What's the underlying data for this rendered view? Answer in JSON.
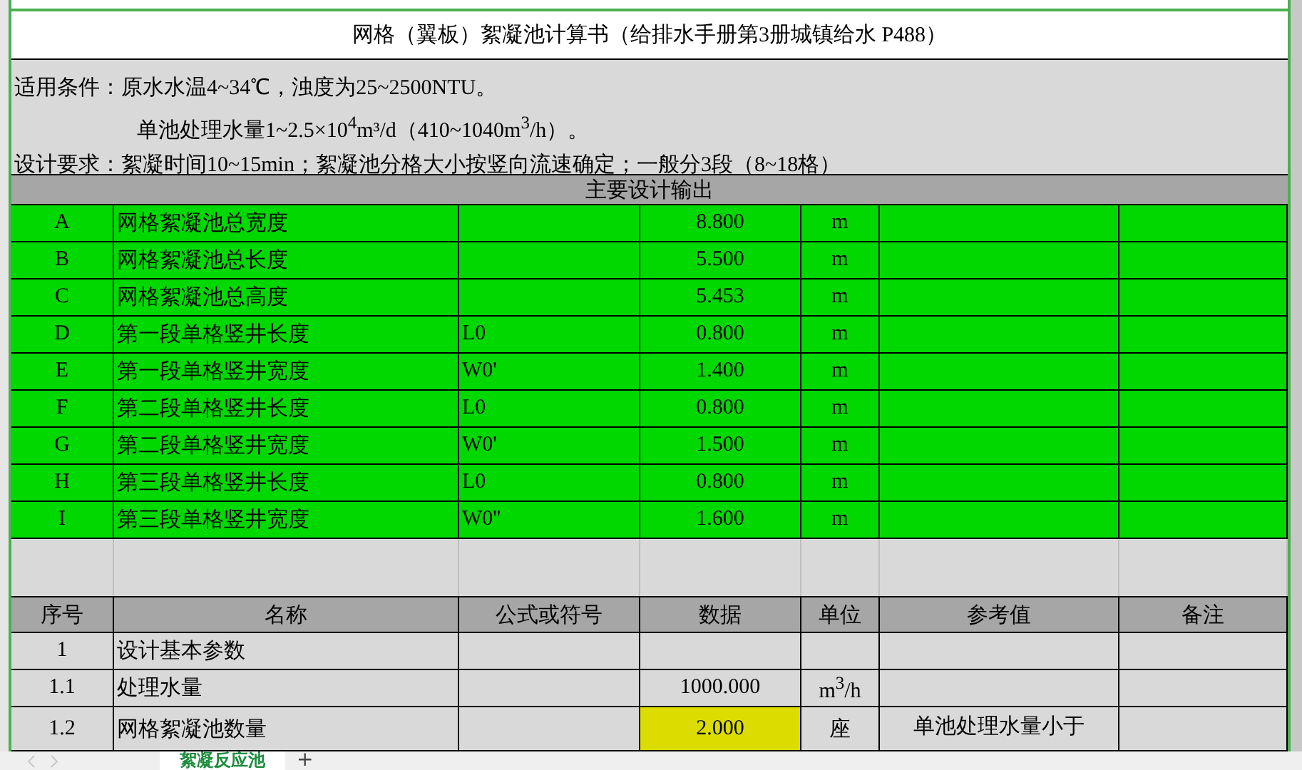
{
  "title": "网格（翼板）絮凝池计算书（给排水手册第3册城镇给水 P488）",
  "conditions": [
    {
      "text": "适用条件：原水水温4~34℃，浊度为25~2500NTU。",
      "indent": false
    },
    {
      "text": "单池处理水量1~2.5×10$^{4}$m³/d（410~1040m$^{3}$/h）。",
      "indent": true
    },
    {
      "text": "设计要求：絮凝时间10~15min；絮凝池分格大小按竖向流速确定；一般分3段（8~18格）",
      "indent": false
    }
  ],
  "output": {
    "heading": "主要设计输出",
    "rows": [
      {
        "code": "A",
        "name": "网格絮凝池总宽度",
        "value": "8.800",
        "unit": "m"
      },
      {
        "code": "B",
        "name": "网格絮凝池总长度",
        "value": "5.500",
        "unit": "m"
      },
      {
        "code": "C",
        "name": "网格絮凝池总高度",
        "value": "5.453",
        "unit": "m"
      },
      {
        "code": "D",
        "name": "第一段单格竖井长度",
        "symbol": "L0",
        "value": "0.800",
        "unit": "m"
      },
      {
        "code": "E",
        "name": "第一段单格竖井宽度",
        "symbol": "W0'",
        "value": "1.400",
        "unit": "m"
      },
      {
        "code": "F",
        "name": "第二段单格竖井长度",
        "symbol": "L0",
        "value": "0.800",
        "unit": "m"
      },
      {
        "code": "G",
        "name": "第二段单格竖井宽度",
        "symbol": "W0'",
        "value": "1.500",
        "unit": "m"
      },
      {
        "code": "H",
        "name": "第三段单格竖井长度",
        "symbol": "L0",
        "value": "0.800",
        "unit": "m"
      },
      {
        "code": "I",
        "name": "第三段单格竖井宽度",
        "symbol": "W0''",
        "value": "1.600",
        "unit": "m"
      }
    ]
  },
  "table": {
    "columns": [
      "序号",
      "名称",
      "公式或符号",
      "数据",
      "单位",
      "参考值",
      "备注"
    ],
    "rows": [
      {
        "no": "1",
        "name": "设计基本参数",
        "highlight": false
      },
      {
        "no": "1.1",
        "name": "处理水量",
        "value": "1000.000",
        "unit": "m$^{3}$/h",
        "highlight": false
      },
      {
        "no": "1.2",
        "name": "网格絮凝池数量",
        "value": "2.000",
        "unit": "座",
        "reference": "单池处理水量小于",
        "highlight": true
      }
    ]
  },
  "sheet_tabs": [
    {
      "label": "絮凝反应池",
      "selected": true
    }
  ],
  "add_sheet": "+"
}
